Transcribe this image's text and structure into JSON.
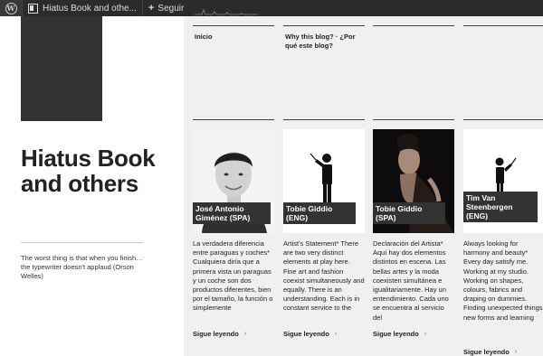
{
  "adminbar": {
    "site_name": "Hiatus Book and othe...",
    "follow_label": "Seguir"
  },
  "site": {
    "title": "Hiatus Book and others",
    "tagline": "The worst thing is that when you finish… the typewriter doesn't applaud (Orson Welles)"
  },
  "nav": {
    "items": [
      {
        "label": "Inicio"
      },
      {
        "label": "Why this blog? · ¿Por qué este blog?"
      }
    ]
  },
  "cards": [
    {
      "name": "José Antonio Giménez (SPA)",
      "excerpt": "La verdadera diferencia entre paraguas y coches* Cualquiera diría que a primera vista un paraguas y un coche son dos productos diferentes, bien por el tamaño, la función o simplemente",
      "more": "Sigue leyendo"
    },
    {
      "name": "Tobie Giddio (ENG)",
      "excerpt": "Artist's Statement* There are two very distinct elements at play here. Fine art and fashion coexist simultaneously and equally. There is an understanding. Each is in constant service to the",
      "more": "Sigue leyendo"
    },
    {
      "name": "Tobie Giddio (SPA)",
      "excerpt": "Declaración del Artista* Aquí hay dos elementos distintos en escena. Las bellas artes y la moda coexisten simultánea e igualitariamente. Hay un entendimiento. Cada uno se encuentra al servicio del",
      "more": "Sigue leyendo"
    },
    {
      "name": "Tim Van Steenbergen (ENG)",
      "excerpt": "Always looking for harmony and beauty* Every day satisfy me. Working at my studio. Working on shapes, colours, fabrics and draping on dummies. Finding unexpected things, new forms and learning",
      "more": "Sigue leyendo"
    }
  ],
  "icons": {
    "wordpress": "wordpress-logo-icon",
    "dashboard": "dashboard-icon",
    "follow": "plus-icon",
    "more_arrow": "arrow-right-icon",
    "conductor": "conductor-figure-icon"
  },
  "colors": {
    "admin_bar": "#2b2b2b",
    "content_bg": "#f0f0f0",
    "name_box": "#333333"
  }
}
